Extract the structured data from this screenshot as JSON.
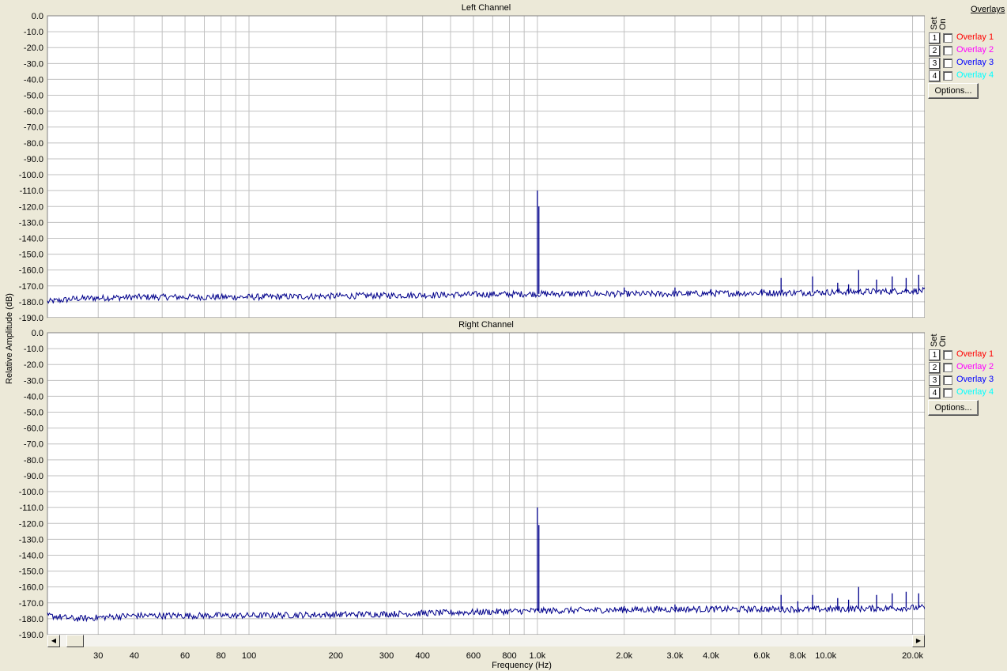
{
  "chart_data": {
    "type": "line",
    "x_scale": "log",
    "xlim": [
      20,
      22050
    ],
    "ylim": [
      -190,
      0
    ],
    "y_ticks": [
      0,
      -10,
      -20,
      -30,
      -40,
      -50,
      -60,
      -70,
      -80,
      -90,
      -100,
      -110,
      -120,
      -130,
      -140,
      -150,
      -160,
      -170,
      -180,
      -190
    ],
    "y_tick_labels": [
      "0.0",
      "-10.0",
      "-20.0",
      "-30.0",
      "-40.0",
      "-50.0",
      "-60.0",
      "-70.0",
      "-80.0",
      "-90.0",
      "-100.0",
      "-110.0",
      "-120.0",
      "-130.0",
      "-140.0",
      "-150.0",
      "-160.0",
      "-170.0",
      "-180.0",
      "-190.0"
    ],
    "x_ticks": [
      30,
      40,
      60,
      80,
      100,
      200,
      300,
      400,
      600,
      800,
      1000,
      2000,
      3000,
      4000,
      6000,
      8000,
      10000,
      20000
    ],
    "x_tick_labels": [
      "30",
      "40",
      "60",
      "80",
      "100",
      "200",
      "300",
      "400",
      "600",
      "800",
      "1.0k",
      "2.0k",
      "3.0k",
      "4.0k",
      "6.0k",
      "8.0k",
      "10.0k",
      "20.0k"
    ],
    "xlabel": "Frequency (Hz)",
    "ylabel": "Relative Amplitude (dB)",
    "grid": true,
    "charts": [
      {
        "title": "Left Channel",
        "series_color": "#00008b",
        "noise_floor": [
          [
            20,
            -180
          ],
          [
            25,
            -178
          ],
          [
            40,
            -177
          ],
          [
            100,
            -177
          ],
          [
            300,
            -176
          ],
          [
            1000,
            -175
          ],
          [
            3000,
            -175
          ],
          [
            10000,
            -174
          ],
          [
            22050,
            -173
          ]
        ],
        "peaks": [
          [
            1000,
            -110
          ],
          [
            1012,
            -120
          ],
          [
            2000,
            -171
          ],
          [
            3000,
            -171
          ],
          [
            4000,
            -172
          ],
          [
            6000,
            -172
          ],
          [
            7000,
            -165
          ],
          [
            9000,
            -164
          ],
          [
            11000,
            -168
          ],
          [
            12000,
            -169
          ],
          [
            13000,
            -160
          ],
          [
            15000,
            -166
          ],
          [
            17000,
            -164
          ],
          [
            19000,
            -165
          ],
          [
            21000,
            -163
          ]
        ]
      },
      {
        "title": "Right Channel",
        "series_color": "#00008b",
        "noise_floor": [
          [
            20,
            -178
          ],
          [
            25,
            -180
          ],
          [
            40,
            -178
          ],
          [
            100,
            -178
          ],
          [
            300,
            -177
          ],
          [
            1000,
            -175
          ],
          [
            3000,
            -174
          ],
          [
            10000,
            -174
          ],
          [
            22050,
            -173
          ]
        ],
        "peaks": [
          [
            1000,
            -110
          ],
          [
            1012,
            -121
          ],
          [
            2000,
            -172
          ],
          [
            3000,
            -171
          ],
          [
            4000,
            -172
          ],
          [
            6000,
            -172
          ],
          [
            7000,
            -165
          ],
          [
            8000,
            -169
          ],
          [
            9000,
            -165
          ],
          [
            11000,
            -167
          ],
          [
            12000,
            -168
          ],
          [
            13000,
            -160
          ],
          [
            15000,
            -165
          ],
          [
            17000,
            -164
          ],
          [
            19000,
            -163
          ],
          [
            21000,
            -164
          ]
        ]
      }
    ]
  },
  "overlays_panel": {
    "title": "Overlays",
    "set_label": "Set",
    "on_label": "On",
    "items": [
      {
        "num": "1",
        "label": "Overlay 1",
        "color": "#ff0000"
      },
      {
        "num": "2",
        "label": "Overlay 2",
        "color": "#ff00ff"
      },
      {
        "num": "3",
        "label": "Overlay 3",
        "color": "#0000ff"
      },
      {
        "num": "4",
        "label": "Overlay 4",
        "color": "#00ffff"
      }
    ],
    "options_label": "Options..."
  },
  "scrollbar": {
    "left_arrow": "◀",
    "right_arrow": "▶"
  }
}
